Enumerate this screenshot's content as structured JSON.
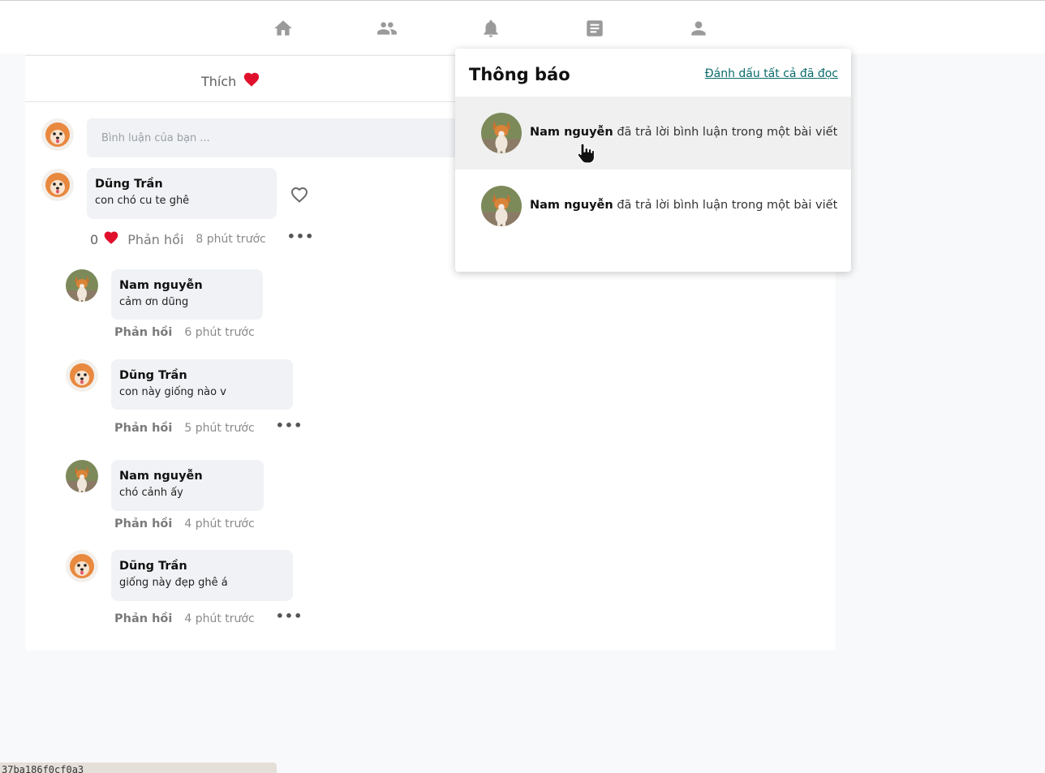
{
  "nav": {
    "icons": [
      "home-icon",
      "friends-icon",
      "bell-icon",
      "document-icon",
      "profile-icon"
    ]
  },
  "post": {
    "like_label": "Thích",
    "comment_placeholder": "Bình luận của bạn ..."
  },
  "comments": [
    {
      "name": "Dũng Trần",
      "text": "con chó cu te ghê",
      "like_count": "0",
      "reply_label": "Phản hồi",
      "time": "8 phút trước",
      "replies": [
        {
          "name": "Nam nguyễn",
          "text": "cảm ơn dũng",
          "reply_label": "Phản hồi",
          "time": "6 phút trước"
        },
        {
          "name": "Dũng Trần",
          "text": "con này giống nào v",
          "reply_label": "Phản hồi",
          "time": "5 phút trước"
        },
        {
          "name": "Nam nguyễn",
          "text": "chó cảnh ấy",
          "reply_label": "Phản hồi",
          "time": "4 phút trước"
        },
        {
          "name": "Dũng Trần",
          "text": "giống này đẹp ghê á",
          "reply_label": "Phản hồi",
          "time": "4 phút trước"
        }
      ]
    }
  ],
  "notifications": {
    "title": "Thông báo",
    "mark_all_read": "Đánh dấu tất cả đã đọc",
    "items": [
      {
        "actor": "Nam nguyễn",
        "message": "đã trả lời bình luận trong một bài viết"
      },
      {
        "actor": "Nam nguyễn",
        "message": "đã trả lời bình luận trong một bài viết"
      }
    ]
  },
  "status_bar": {
    "text": "37ba186f0cf0a3"
  },
  "colors": {
    "like_red": "#e0102c",
    "link_teal": "#0b6b6b",
    "bubble_bg": "#f0f2f5"
  }
}
